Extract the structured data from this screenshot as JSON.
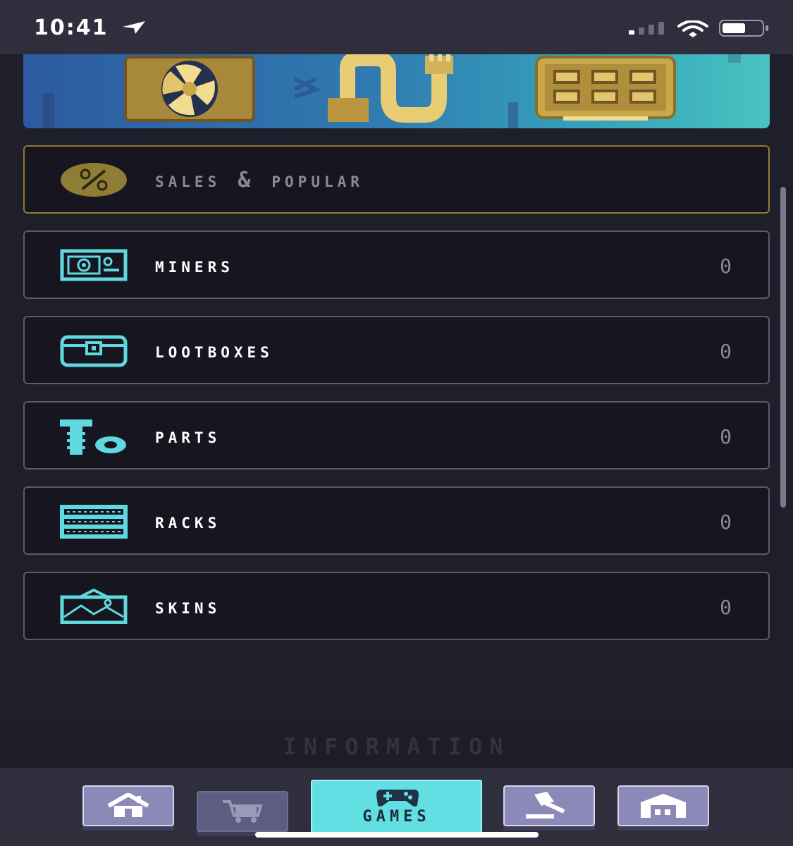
{
  "status_bar": {
    "time": "10:41"
  },
  "categories": [
    {
      "label": "Sales & Popular",
      "count": "",
      "icon": "percent-badge-icon"
    },
    {
      "label": "Miners",
      "count": "0",
      "icon": "miner-icon"
    },
    {
      "label": "Lootboxes",
      "count": "0",
      "icon": "lootbox-icon"
    },
    {
      "label": "Parts",
      "count": "0",
      "icon": "screw-nut-icon"
    },
    {
      "label": "Racks",
      "count": "0",
      "icon": "rack-icon"
    },
    {
      "label": "Skins",
      "count": "0",
      "icon": "skin-image-icon"
    }
  ],
  "information": {
    "label": "INFORMATION"
  },
  "bottom_nav": {
    "items": [
      {
        "id": "home",
        "icon": "home-icon",
        "active": false
      },
      {
        "id": "market",
        "icon": "cart-icon",
        "active": false
      },
      {
        "id": "games",
        "icon": "gamepad-icon",
        "label": "GAMES",
        "active": true
      },
      {
        "id": "auction",
        "icon": "gavel-icon",
        "active": false
      },
      {
        "id": "storage",
        "icon": "warehouse-icon",
        "active": false
      }
    ]
  },
  "colors": {
    "background": "#1f1e2b",
    "row_bg": "#171620",
    "row_border": "#5b5a72",
    "sales_border": "#8e7d32",
    "accent_cyan": "#62dfe3",
    "gold": "#c9a84a",
    "nav_button": "#8c89b8"
  }
}
